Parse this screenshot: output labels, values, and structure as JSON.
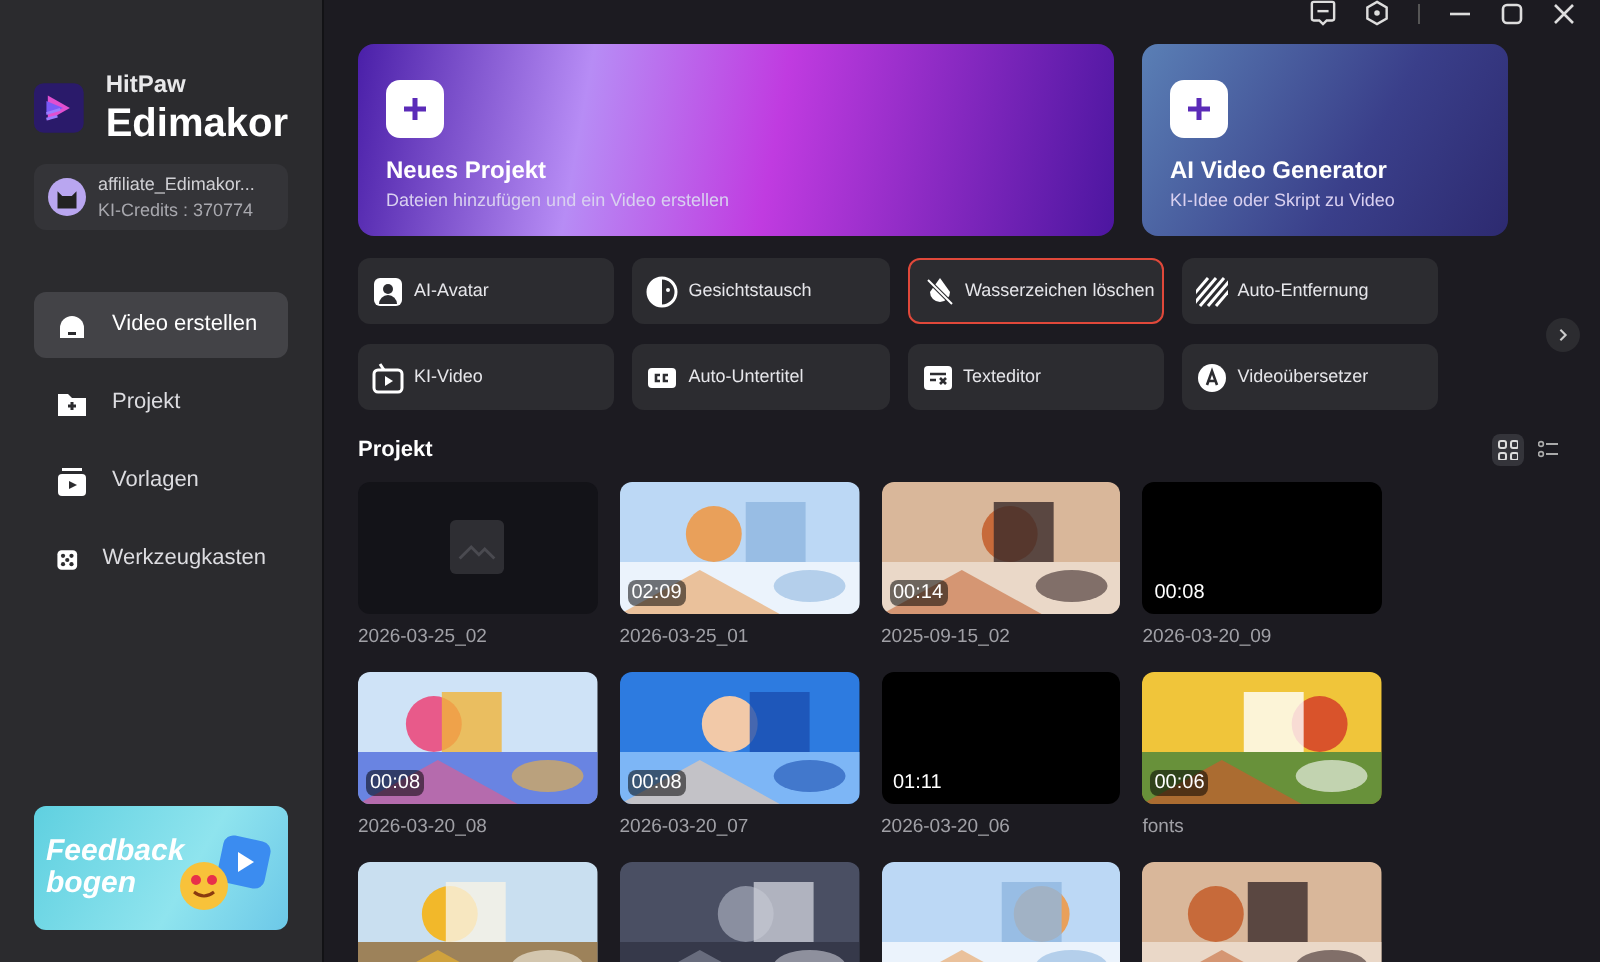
{
  "app": {
    "brand_top": "HitPaw",
    "brand_name": "Edimakor"
  },
  "account": {
    "name": "affiliate_Edimakor...",
    "credits": "KI-Credits : 370774"
  },
  "nav": [
    {
      "label": "Video erstellen",
      "selected": true
    },
    {
      "label": "Projekt",
      "selected": false
    },
    {
      "label": "Vorlagen",
      "selected": false
    },
    {
      "label": "Werkzeugkasten",
      "selected": false
    }
  ],
  "feedback": {
    "label": "Feedback bogen"
  },
  "hero": [
    {
      "title": "Neues Projekt",
      "subtitle": "Dateien hinzufügen und ein Video erstellen",
      "kind": "purple"
    },
    {
      "title": "AI Video Generator",
      "subtitle": "KI-Idee oder Skript zu Video",
      "kind": "blue"
    }
  ],
  "tools": [
    {
      "label": "AI-Avatar",
      "selected": false
    },
    {
      "label": "Gesichtstausch",
      "selected": false
    },
    {
      "label": "Wasserzeichen löschen",
      "selected": true
    },
    {
      "label": "Auto-Entfernung",
      "selected": false
    },
    {
      "label": "KI-Video",
      "selected": false
    },
    {
      "label": "Auto-Untertitel",
      "selected": false
    },
    {
      "label": "Texteditor",
      "selected": false
    },
    {
      "label": "Videoübersetzer",
      "selected": false
    }
  ],
  "section": {
    "title": "Projekt"
  },
  "view_toggle": [
    {
      "selected": true
    },
    {
      "selected": false
    }
  ],
  "projects": [
    {
      "kind": "empty",
      "name": "2026-03-25_02"
    },
    {
      "kind": "picture",
      "duration": "02:09",
      "name": "2026-03-25_01"
    },
    {
      "kind": "picture",
      "duration": "00:14",
      "name": "2025-09-15_02"
    },
    {
      "kind": "black",
      "duration": "00:08",
      "name": "2026-03-20_09"
    },
    {
      "kind": "picture",
      "duration": "00:08",
      "name": "2026-03-20_08"
    },
    {
      "kind": "picture",
      "duration": "00:08",
      "name": "2026-03-20_07"
    },
    {
      "kind": "black",
      "duration": "01:11",
      "name": "2026-03-20_06"
    },
    {
      "kind": "picture",
      "duration": "00:06",
      "name": "fonts"
    },
    {
      "kind": "picture"
    },
    {
      "kind": "picture"
    },
    {
      "kind": "picture"
    },
    {
      "kind": "picture"
    }
  ]
}
